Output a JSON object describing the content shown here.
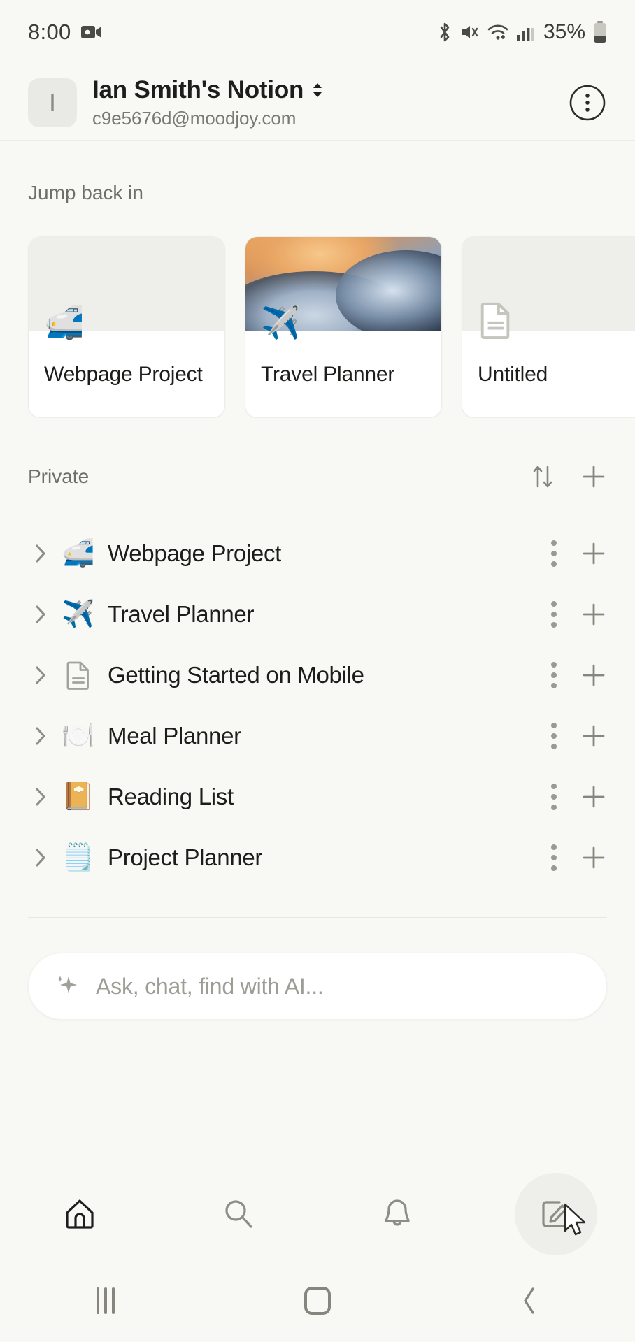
{
  "status_bar": {
    "time": "8:00",
    "battery_percent": "35%",
    "icons": [
      "video-camera-icon",
      "bluetooth-icon",
      "mute-icon",
      "wifi-icon",
      "cellular-signal-icon",
      "battery-icon"
    ]
  },
  "workspace": {
    "avatar_letter": "I",
    "name": "Ian Smith's Notion",
    "email": "c9e5676d@moodjoy.com",
    "chevron_icon": "chevron-up-down-icon",
    "more_icon": "more-options-circle-icon"
  },
  "jump_back_in": {
    "label": "Jump back in",
    "cards": [
      {
        "title": "Webpage Project",
        "emoji": "🚅",
        "icon_name": "bullet-train-emoji",
        "cover": "plain"
      },
      {
        "title": "Travel Planner",
        "emoji": "✈️",
        "icon_name": "airplane-emoji",
        "cover": "sky-photo"
      },
      {
        "title": "Untitled",
        "emoji": "",
        "icon_name": "document-icon",
        "cover": "plain"
      }
    ]
  },
  "private": {
    "label": "Private",
    "sort_icon": "sort-arrows-icon",
    "add_icon": "plus-icon",
    "items": [
      {
        "label": "Webpage Project",
        "emoji": "🚅",
        "icon_name": "bullet-train-emoji"
      },
      {
        "label": "Travel Planner",
        "emoji": "✈️",
        "icon_name": "airplane-emoji"
      },
      {
        "label": "Getting Started on Mobile",
        "emoji": "",
        "icon_name": "document-icon"
      },
      {
        "label": "Meal Planner",
        "emoji": "🍽️",
        "icon_name": "fork-and-plate-emoji"
      },
      {
        "label": "Reading List",
        "emoji": "📔",
        "icon_name": "notebook-emoji"
      },
      {
        "label": "Project Planner",
        "emoji": "🗒️",
        "icon_name": "checklist-emoji"
      }
    ],
    "row_menu_icon": "more-dots-vertical-icon",
    "row_add_icon": "plus-icon",
    "expand_icon": "chevron-right-icon"
  },
  "ai_search": {
    "placeholder": "Ask, chat, find with AI...",
    "value": "",
    "icon": "sparkle-ai-icon"
  },
  "bottom_nav": {
    "items": [
      {
        "name": "home",
        "icon": "home-icon",
        "active": true
      },
      {
        "name": "search",
        "icon": "search-icon",
        "active": false
      },
      {
        "name": "inbox",
        "icon": "bell-icon",
        "active": false
      },
      {
        "name": "new-page",
        "icon": "compose-edit-icon",
        "active": false,
        "highlighted": true
      }
    ]
  },
  "system_nav": {
    "recents_icon": "recents-icon",
    "home_icon": "system-home-icon",
    "back_icon": "back-chevron-icon"
  },
  "colors": {
    "background": "#f8f8f5",
    "card": "#ffffff",
    "text_primary": "#1d1d1b",
    "text_secondary": "#6f6f68",
    "muted": "#9d9d95"
  }
}
